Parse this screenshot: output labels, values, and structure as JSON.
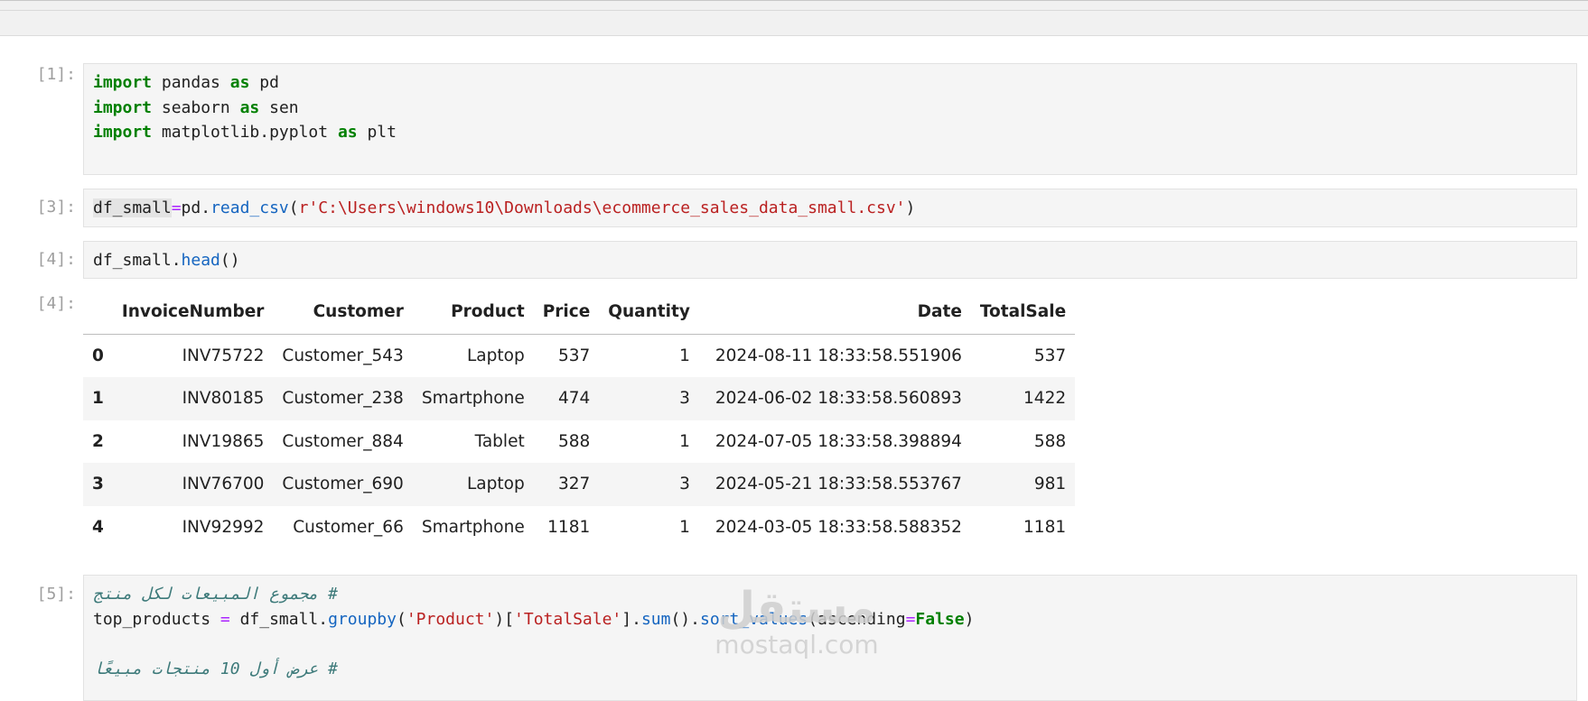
{
  "cells": [
    {
      "prompt": "[1]:",
      "lines": [
        [
          {
            "t": "import",
            "c": "kw"
          },
          {
            "t": " pandas "
          },
          {
            "t": "as",
            "c": "kw"
          },
          {
            "t": " pd"
          }
        ],
        [
          {
            "t": "import",
            "c": "kw"
          },
          {
            "t": " seaborn "
          },
          {
            "t": "as",
            "c": "kw"
          },
          {
            "t": " sen"
          }
        ],
        [
          {
            "t": "import",
            "c": "kw"
          },
          {
            "t": " matplotlib.pyplot "
          },
          {
            "t": "as",
            "c": "kw"
          },
          {
            "t": " plt"
          }
        ],
        []
      ]
    },
    {
      "prompt": "[3]:",
      "lines": [
        [
          {
            "t": "df_small",
            "c": "hl"
          },
          {
            "t": "=",
            "c": "op"
          },
          {
            "t": "pd."
          },
          {
            "t": "read_csv",
            "c": "fn"
          },
          {
            "t": "("
          },
          {
            "t": "r'C:\\Users\\windows10\\Downloads\\ecommerce_sales_data_small.csv'",
            "c": "str"
          },
          {
            "t": ")"
          }
        ]
      ]
    },
    {
      "prompt": "[4]:",
      "lines": [
        [
          {
            "t": "df_small."
          },
          {
            "t": "head",
            "c": "fn"
          },
          {
            "t": "()"
          }
        ]
      ]
    },
    {
      "prompt": "[5]:",
      "lines": [
        [
          {
            "t": "# مجموع المبيعات لكل منتج",
            "c": "cmt"
          }
        ],
        [
          {
            "t": "top_products "
          },
          {
            "t": "=",
            "c": "op"
          },
          {
            "t": " df_small."
          },
          {
            "t": "groupby",
            "c": "fn"
          },
          {
            "t": "("
          },
          {
            "t": "'Product'",
            "c": "str"
          },
          {
            "t": ")["
          },
          {
            "t": "'TotalSale'",
            "c": "str"
          },
          {
            "t": "]."
          },
          {
            "t": "sum",
            "c": "fn"
          },
          {
            "t": "()."
          },
          {
            "t": "sort_values",
            "c": "fn"
          },
          {
            "t": "(ascending"
          },
          {
            "t": "=",
            "c": "op"
          },
          {
            "t": "False",
            "c": "kw"
          },
          {
            "t": ")"
          }
        ],
        [],
        [
          {
            "t": "# عرض أول 10 منتجات مبيعًا",
            "c": "cmt"
          }
        ]
      ]
    }
  ],
  "output": {
    "prompt": "[4]:",
    "columns": [
      "",
      "InvoiceNumber",
      "Customer",
      "Product",
      "Price",
      "Quantity",
      "Date",
      "TotalSale"
    ],
    "rows": [
      [
        "0",
        "INV75722",
        "Customer_543",
        "Laptop",
        "537",
        "1",
        "2024-08-11 18:33:58.551906",
        "537"
      ],
      [
        "1",
        "INV80185",
        "Customer_238",
        "Smartphone",
        "474",
        "3",
        "2024-06-02 18:33:58.560893",
        "1422"
      ],
      [
        "2",
        "INV19865",
        "Customer_884",
        "Tablet",
        "588",
        "1",
        "2024-07-05 18:33:58.398894",
        "588"
      ],
      [
        "3",
        "INV76700",
        "Customer_690",
        "Laptop",
        "327",
        "3",
        "2024-05-21 18:33:58.553767",
        "981"
      ],
      [
        "4",
        "INV92992",
        "Customer_66",
        "Smartphone",
        "1181",
        "1",
        "2024-03-05 18:33:58.588352",
        "1181"
      ]
    ]
  },
  "watermark": {
    "arabic": "مستقل",
    "latin": "mostaql.com"
  }
}
